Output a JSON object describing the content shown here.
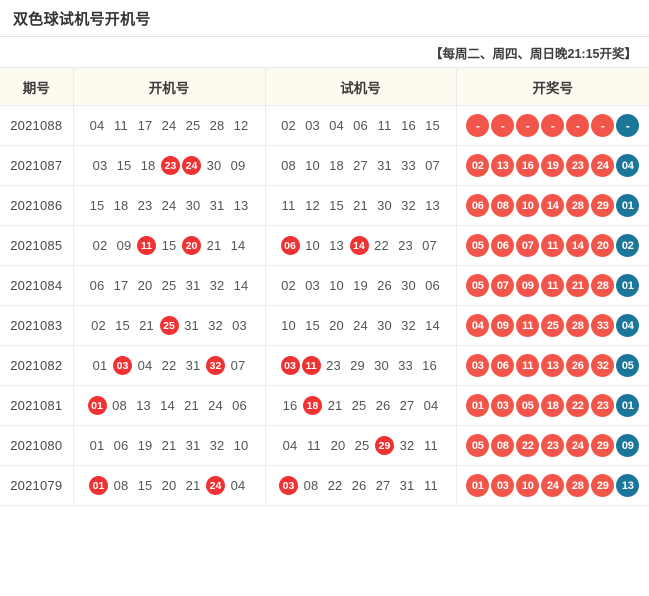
{
  "header": {
    "title": "双色球试机号开机号",
    "note": "【每周二、周四、周日晚21:15开奖】"
  },
  "table": {
    "columns": [
      "期号",
      "开机号",
      "试机号",
      "开奖号"
    ],
    "colors": {
      "red_ball": "#f2564b",
      "blue_ball": "#1b7799",
      "hit_marker": "#f03232",
      "header_bg": "#fdfbf0",
      "border": "#ececec"
    },
    "rows": [
      {
        "issue": "2021088",
        "kaiji": [
          {
            "v": "04",
            "hit": false
          },
          {
            "v": "11",
            "hit": false
          },
          {
            "v": "17",
            "hit": false
          },
          {
            "v": "24",
            "hit": false
          },
          {
            "v": "25",
            "hit": false
          },
          {
            "v": "28",
            "hit": false
          },
          {
            "v": "12",
            "hit": false
          }
        ],
        "shiji": [
          {
            "v": "02",
            "hit": false
          },
          {
            "v": "03",
            "hit": false
          },
          {
            "v": "04",
            "hit": false
          },
          {
            "v": "06",
            "hit": false
          },
          {
            "v": "11",
            "hit": false
          },
          {
            "v": "16",
            "hit": false
          },
          {
            "v": "15",
            "hit": false
          }
        ],
        "kaijiang": [
          {
            "v": "-",
            "c": "red"
          },
          {
            "v": "-",
            "c": "red"
          },
          {
            "v": "-",
            "c": "red"
          },
          {
            "v": "-",
            "c": "red"
          },
          {
            "v": "-",
            "c": "red"
          },
          {
            "v": "-",
            "c": "red"
          },
          {
            "v": "-",
            "c": "blue"
          }
        ]
      },
      {
        "issue": "2021087",
        "kaiji": [
          {
            "v": "03",
            "hit": false
          },
          {
            "v": "15",
            "hit": false
          },
          {
            "v": "18",
            "hit": false
          },
          {
            "v": "23",
            "hit": true
          },
          {
            "v": "24",
            "hit": true
          },
          {
            "v": "30",
            "hit": false
          },
          {
            "v": "09",
            "hit": false
          }
        ],
        "shiji": [
          {
            "v": "08",
            "hit": false
          },
          {
            "v": "10",
            "hit": false
          },
          {
            "v": "18",
            "hit": false
          },
          {
            "v": "27",
            "hit": false
          },
          {
            "v": "31",
            "hit": false
          },
          {
            "v": "33",
            "hit": false
          },
          {
            "v": "07",
            "hit": false
          }
        ],
        "kaijiang": [
          {
            "v": "02",
            "c": "red"
          },
          {
            "v": "13",
            "c": "red"
          },
          {
            "v": "16",
            "c": "red"
          },
          {
            "v": "19",
            "c": "red"
          },
          {
            "v": "23",
            "c": "red"
          },
          {
            "v": "24",
            "c": "red"
          },
          {
            "v": "04",
            "c": "blue"
          }
        ]
      },
      {
        "issue": "2021086",
        "kaiji": [
          {
            "v": "15",
            "hit": false
          },
          {
            "v": "18",
            "hit": false
          },
          {
            "v": "23",
            "hit": false
          },
          {
            "v": "24",
            "hit": false
          },
          {
            "v": "30",
            "hit": false
          },
          {
            "v": "31",
            "hit": false
          },
          {
            "v": "13",
            "hit": false
          }
        ],
        "shiji": [
          {
            "v": "11",
            "hit": false
          },
          {
            "v": "12",
            "hit": false
          },
          {
            "v": "15",
            "hit": false
          },
          {
            "v": "21",
            "hit": false
          },
          {
            "v": "30",
            "hit": false
          },
          {
            "v": "32",
            "hit": false
          },
          {
            "v": "13",
            "hit": false
          }
        ],
        "kaijiang": [
          {
            "v": "06",
            "c": "red"
          },
          {
            "v": "08",
            "c": "red"
          },
          {
            "v": "10",
            "c": "red"
          },
          {
            "v": "14",
            "c": "red"
          },
          {
            "v": "28",
            "c": "red"
          },
          {
            "v": "29",
            "c": "red"
          },
          {
            "v": "01",
            "c": "blue"
          }
        ]
      },
      {
        "issue": "2021085",
        "kaiji": [
          {
            "v": "02",
            "hit": false
          },
          {
            "v": "09",
            "hit": false
          },
          {
            "v": "11",
            "hit": true
          },
          {
            "v": "15",
            "hit": false
          },
          {
            "v": "20",
            "hit": true
          },
          {
            "v": "21",
            "hit": false
          },
          {
            "v": "14",
            "hit": false
          }
        ],
        "shiji": [
          {
            "v": "06",
            "hit": true
          },
          {
            "v": "10",
            "hit": false
          },
          {
            "v": "13",
            "hit": false
          },
          {
            "v": "14",
            "hit": true
          },
          {
            "v": "22",
            "hit": false
          },
          {
            "v": "23",
            "hit": false
          },
          {
            "v": "07",
            "hit": false
          }
        ],
        "kaijiang": [
          {
            "v": "05",
            "c": "red"
          },
          {
            "v": "06",
            "c": "red"
          },
          {
            "v": "07",
            "c": "red"
          },
          {
            "v": "11",
            "c": "red"
          },
          {
            "v": "14",
            "c": "red"
          },
          {
            "v": "20",
            "c": "red"
          },
          {
            "v": "02",
            "c": "blue"
          }
        ]
      },
      {
        "issue": "2021084",
        "kaiji": [
          {
            "v": "06",
            "hit": false
          },
          {
            "v": "17",
            "hit": false
          },
          {
            "v": "20",
            "hit": false
          },
          {
            "v": "25",
            "hit": false
          },
          {
            "v": "31",
            "hit": false
          },
          {
            "v": "32",
            "hit": false
          },
          {
            "v": "14",
            "hit": false
          }
        ],
        "shiji": [
          {
            "v": "02",
            "hit": false
          },
          {
            "v": "03",
            "hit": false
          },
          {
            "v": "10",
            "hit": false
          },
          {
            "v": "19",
            "hit": false
          },
          {
            "v": "26",
            "hit": false
          },
          {
            "v": "30",
            "hit": false
          },
          {
            "v": "06",
            "hit": false
          }
        ],
        "kaijiang": [
          {
            "v": "05",
            "c": "red"
          },
          {
            "v": "07",
            "c": "red"
          },
          {
            "v": "09",
            "c": "red"
          },
          {
            "v": "11",
            "c": "red"
          },
          {
            "v": "21",
            "c": "red"
          },
          {
            "v": "28",
            "c": "red"
          },
          {
            "v": "01",
            "c": "blue"
          }
        ]
      },
      {
        "issue": "2021083",
        "kaiji": [
          {
            "v": "02",
            "hit": false
          },
          {
            "v": "15",
            "hit": false
          },
          {
            "v": "21",
            "hit": false
          },
          {
            "v": "25",
            "hit": true
          },
          {
            "v": "31",
            "hit": false
          },
          {
            "v": "32",
            "hit": false
          },
          {
            "v": "03",
            "hit": false
          }
        ],
        "shiji": [
          {
            "v": "10",
            "hit": false
          },
          {
            "v": "15",
            "hit": false
          },
          {
            "v": "20",
            "hit": false
          },
          {
            "v": "24",
            "hit": false
          },
          {
            "v": "30",
            "hit": false
          },
          {
            "v": "32",
            "hit": false
          },
          {
            "v": "14",
            "hit": false
          }
        ],
        "kaijiang": [
          {
            "v": "04",
            "c": "red"
          },
          {
            "v": "09",
            "c": "red"
          },
          {
            "v": "11",
            "c": "red"
          },
          {
            "v": "25",
            "c": "red"
          },
          {
            "v": "28",
            "c": "red"
          },
          {
            "v": "33",
            "c": "red"
          },
          {
            "v": "04",
            "c": "blue"
          }
        ]
      },
      {
        "issue": "2021082",
        "kaiji": [
          {
            "v": "01",
            "hit": false
          },
          {
            "v": "03",
            "hit": true
          },
          {
            "v": "04",
            "hit": false
          },
          {
            "v": "22",
            "hit": false
          },
          {
            "v": "31",
            "hit": false
          },
          {
            "v": "32",
            "hit": true
          },
          {
            "v": "07",
            "hit": false
          }
        ],
        "shiji": [
          {
            "v": "03",
            "hit": true
          },
          {
            "v": "11",
            "hit": true
          },
          {
            "v": "23",
            "hit": false
          },
          {
            "v": "29",
            "hit": false
          },
          {
            "v": "30",
            "hit": false
          },
          {
            "v": "33",
            "hit": false
          },
          {
            "v": "16",
            "hit": false
          }
        ],
        "kaijiang": [
          {
            "v": "03",
            "c": "red"
          },
          {
            "v": "06",
            "c": "red"
          },
          {
            "v": "11",
            "c": "red"
          },
          {
            "v": "13",
            "c": "red"
          },
          {
            "v": "26",
            "c": "red"
          },
          {
            "v": "32",
            "c": "red"
          },
          {
            "v": "05",
            "c": "blue"
          }
        ]
      },
      {
        "issue": "2021081",
        "kaiji": [
          {
            "v": "01",
            "hit": true
          },
          {
            "v": "08",
            "hit": false
          },
          {
            "v": "13",
            "hit": false
          },
          {
            "v": "14",
            "hit": false
          },
          {
            "v": "21",
            "hit": false
          },
          {
            "v": "24",
            "hit": false
          },
          {
            "v": "06",
            "hit": false
          }
        ],
        "shiji": [
          {
            "v": "16",
            "hit": false
          },
          {
            "v": "18",
            "hit": true
          },
          {
            "v": "21",
            "hit": false
          },
          {
            "v": "25",
            "hit": false
          },
          {
            "v": "26",
            "hit": false
          },
          {
            "v": "27",
            "hit": false
          },
          {
            "v": "04",
            "hit": false
          }
        ],
        "kaijiang": [
          {
            "v": "01",
            "c": "red"
          },
          {
            "v": "03",
            "c": "red"
          },
          {
            "v": "05",
            "c": "red"
          },
          {
            "v": "18",
            "c": "red"
          },
          {
            "v": "22",
            "c": "red"
          },
          {
            "v": "23",
            "c": "red"
          },
          {
            "v": "01",
            "c": "blue"
          }
        ]
      },
      {
        "issue": "2021080",
        "kaiji": [
          {
            "v": "01",
            "hit": false
          },
          {
            "v": "06",
            "hit": false
          },
          {
            "v": "19",
            "hit": false
          },
          {
            "v": "21",
            "hit": false
          },
          {
            "v": "31",
            "hit": false
          },
          {
            "v": "32",
            "hit": false
          },
          {
            "v": "10",
            "hit": false
          }
        ],
        "shiji": [
          {
            "v": "04",
            "hit": false
          },
          {
            "v": "11",
            "hit": false
          },
          {
            "v": "20",
            "hit": false
          },
          {
            "v": "25",
            "hit": false
          },
          {
            "v": "29",
            "hit": true
          },
          {
            "v": "32",
            "hit": false
          },
          {
            "v": "11",
            "hit": false
          }
        ],
        "kaijiang": [
          {
            "v": "05",
            "c": "red"
          },
          {
            "v": "08",
            "c": "red"
          },
          {
            "v": "22",
            "c": "red"
          },
          {
            "v": "23",
            "c": "red"
          },
          {
            "v": "24",
            "c": "red"
          },
          {
            "v": "29",
            "c": "red"
          },
          {
            "v": "09",
            "c": "blue"
          }
        ]
      },
      {
        "issue": "2021079",
        "kaiji": [
          {
            "v": "01",
            "hit": true
          },
          {
            "v": "08",
            "hit": false
          },
          {
            "v": "15",
            "hit": false
          },
          {
            "v": "20",
            "hit": false
          },
          {
            "v": "21",
            "hit": false
          },
          {
            "v": "24",
            "hit": true
          },
          {
            "v": "04",
            "hit": false
          }
        ],
        "shiji": [
          {
            "v": "03",
            "hit": true
          },
          {
            "v": "08",
            "hit": false
          },
          {
            "v": "22",
            "hit": false
          },
          {
            "v": "26",
            "hit": false
          },
          {
            "v": "27",
            "hit": false
          },
          {
            "v": "31",
            "hit": false
          },
          {
            "v": "11",
            "hit": false
          }
        ],
        "kaijiang": [
          {
            "v": "01",
            "c": "red"
          },
          {
            "v": "03",
            "c": "red"
          },
          {
            "v": "10",
            "c": "red"
          },
          {
            "v": "24",
            "c": "red"
          },
          {
            "v": "28",
            "c": "red"
          },
          {
            "v": "29",
            "c": "red"
          },
          {
            "v": "13",
            "c": "blue"
          }
        ]
      }
    ]
  }
}
